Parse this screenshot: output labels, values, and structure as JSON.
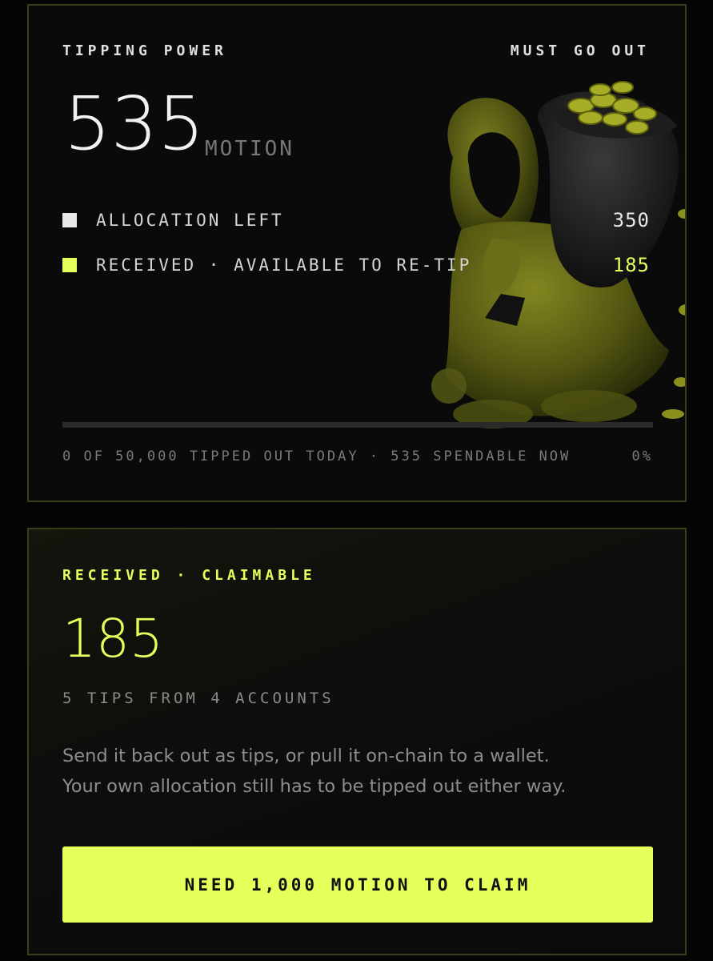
{
  "power": {
    "title": "TIPPING POWER",
    "badge": "MUST GO OUT",
    "total": "535",
    "unit": "MOTION",
    "rows": [
      {
        "label": "ALLOCATION LEFT",
        "value": "350",
        "color": "#e8e8e8"
      },
      {
        "label": "RECEIVED · AVAILABLE TO RE-TIP",
        "value": "185",
        "color": "#e6ff5a"
      }
    ],
    "progress_fraction": 0,
    "progress_text": "0 OF 50,000 TIPPED OUT TODAY · 535 SPENDABLE NOW",
    "progress_percent": "0%",
    "mascot_icon": "hooded-figure-with-coin-sack-icon"
  },
  "claim": {
    "title": "RECEIVED · CLAIMABLE",
    "amount": "185",
    "subtitle": "5 TIPS FROM 4 ACCOUNTS",
    "description_line1": "Send it back out as tips, or pull it on-chain to a wallet.",
    "description_line2": "Your own allocation still has to be tipped out either way.",
    "button_label": "NEED 1,000 MOTION TO CLAIM"
  },
  "colors": {
    "accent": "#e6ff5a",
    "background": "#050505",
    "card_border": "#3a3f1a"
  }
}
